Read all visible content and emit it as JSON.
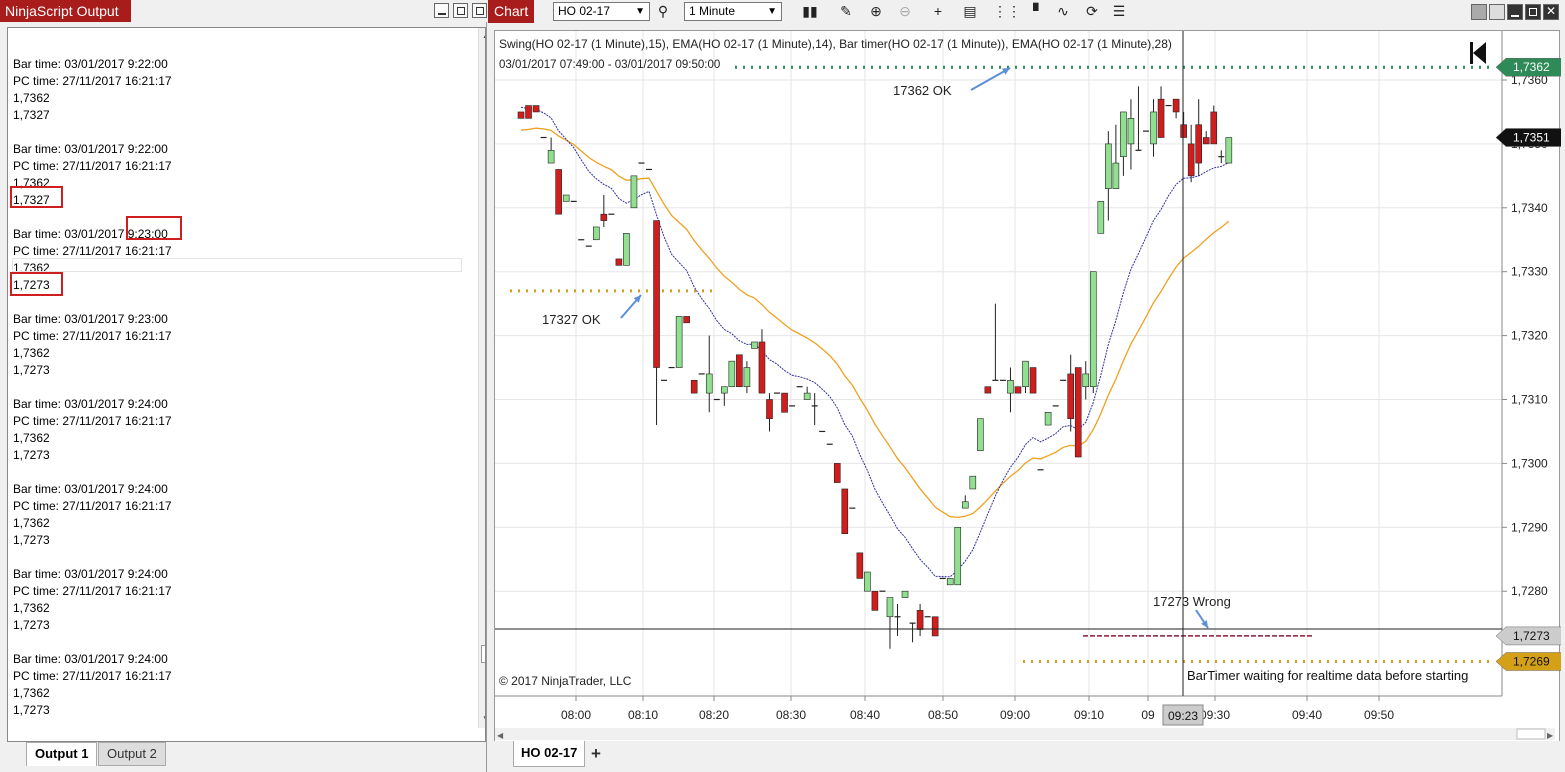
{
  "output": {
    "title": "NinjaScript Output",
    "blocks": [
      {
        "bar": "Bar time: 03/01/2017 9:22:00",
        "pc": "PC time: 27/11/2017 16:21:17",
        "v1": "1,7362",
        "v2": "1,7327"
      },
      {
        "bar": "Bar time: 03/01/2017 9:22:00",
        "pc": "PC time: 27/11/2017 16:21:17",
        "v1": "1,7362",
        "v2": "1,7327"
      },
      {
        "bar": "Bar time: 03/01/2017 9:23:00",
        "pc": "PC time: 27/11/2017 16:21:17",
        "v1": "1,7362",
        "v2": "1,7273"
      },
      {
        "bar": "Bar time: 03/01/2017 9:23:00",
        "pc": "PC time: 27/11/2017 16:21:17",
        "v1": "1,7362",
        "v2": "1,7273"
      },
      {
        "bar": "Bar time: 03/01/2017 9:24:00",
        "pc": "PC time: 27/11/2017 16:21:17",
        "v1": "1,7362",
        "v2": "1,7273"
      },
      {
        "bar": "Bar time: 03/01/2017 9:24:00",
        "pc": "PC time: 27/11/2017 16:21:17",
        "v1": "1,7362",
        "v2": "1,7273"
      },
      {
        "bar": "Bar time: 03/01/2017 9:24:00",
        "pc": "PC time: 27/11/2017 16:21:17",
        "v1": "1,7362",
        "v2": "1,7273"
      },
      {
        "bar": "Bar time: 03/01/2017 9:24:00",
        "pc": "PC time: 27/11/2017 16:21:17",
        "v1": "1,7362",
        "v2": "1,7273"
      }
    ],
    "tabs": [
      "Output 1",
      "Output 2"
    ]
  },
  "chart": {
    "title": "Chart",
    "instrument": "HO 02-17",
    "interval": "1 Minute",
    "indicator_line": "Swing(HO 02-17 (1 Minute),15), EMA(HO 02-17 (1 Minute),14), Bar timer(HO 02-17 (1 Minute)), EMA(HO 02-17 (1 Minute),28)",
    "range_line": "03/01/2017 07:49:00 - 03/01/2017 09:50:00",
    "copyright": "© 2017 NinjaTrader, LLC",
    "bartimer_msg": "BarTimer waiting for realtime data before starting",
    "annotations": [
      "17362  OK",
      "17327  OK",
      "17273  Wrong"
    ],
    "y_ticks": [
      "1,7360",
      "1,7350",
      "1,7340",
      "1,7330",
      "1,7320",
      "1,7310",
      "1,7300",
      "1,7290",
      "1,7280"
    ],
    "x_ticks": [
      "08:00",
      "08:10",
      "08:20",
      "08:30",
      "08:40",
      "08:50",
      "09:00",
      "09:10",
      "09",
      "09:30",
      "09:40",
      "09:50"
    ],
    "crosshair_time": "09:23",
    "price_tags": {
      "swing_high": "1,7362",
      "last": "1,7351",
      "crosshair": "1,7273",
      "swing_low": "1,7269"
    },
    "tab": "HO 02-17",
    "colors": {
      "up": "#90e090",
      "down": "#d01e1e",
      "ema14": "#3030a0",
      "ema28": "#f0a020",
      "swing_high": "#2e8b57",
      "swing_low": "#d4a017",
      "arrow": "#5b8fd8",
      "title_bar": "#a81c1c"
    }
  },
  "chart_data": {
    "type": "candlestick",
    "ylim": [
      1.7265,
      1.7363
    ],
    "candles": [
      [
        1.7355,
        1.7354,
        1.7354,
        1.7354
      ],
      [
        1.7356,
        1.7354,
        1.7355,
        1.7354
      ],
      [
        1.7356,
        1.7355,
        1.7355,
        1.7355
      ],
      [
        1.7351,
        1.7351,
        1.7351,
        1.7351
      ],
      [
        1.7347,
        1.7349,
        1.7351,
        1.7347
      ],
      [
        1.7346,
        1.7339,
        1.7346,
        1.7339
      ],
      [
        1.7341,
        1.7342,
        1.7342,
        1.7341
      ],
      [
        1.7341,
        1.7341,
        1.7341,
        1.7341
      ],
      [
        1.7335,
        1.7335,
        1.7335,
        1.7335
      ],
      [
        1.7334,
        1.7334,
        1.7334,
        1.7334
      ],
      [
        1.7335,
        1.7337,
        1.7337,
        1.7335
      ],
      [
        1.7339,
        1.7338,
        1.7342,
        1.7337
      ],
      [
        1.7339,
        1.7339,
        1.7339,
        1.7339
      ],
      [
        1.7332,
        1.7331,
        1.7332,
        1.7331
      ],
      [
        1.7331,
        1.7336,
        1.7336,
        1.7331
      ],
      [
        1.734,
        1.7345,
        1.7345,
        1.734
      ],
      [
        1.7347,
        1.7347,
        1.7347,
        1.7347
      ],
      [
        1.7346,
        1.7346,
        1.7346,
        1.7346
      ],
      [
        1.7338,
        1.7315,
        1.7338,
        1.7306
      ],
      [
        1.7313,
        1.7313,
        1.7313,
        1.7313
      ],
      [
        1.7315,
        1.7315,
        1.7315,
        1.7315
      ],
      [
        1.7315,
        1.7323,
        1.7323,
        1.7315
      ],
      [
        1.7323,
        1.7322,
        1.7323,
        1.7322
      ],
      [
        1.7313,
        1.7311,
        1.7313,
        1.7311
      ],
      [
        1.7314,
        1.7314,
        1.7314,
        1.7314
      ],
      [
        1.7311,
        1.7314,
        1.732,
        1.7308
      ],
      [
        1.731,
        1.731,
        1.731,
        1.731
      ],
      [
        1.7311,
        1.7312,
        1.7312,
        1.7309
      ],
      [
        1.7312,
        1.7316,
        1.7316,
        1.7312
      ],
      [
        1.7317,
        1.7312,
        1.7317,
        1.7312
      ],
      [
        1.7312,
        1.7315,
        1.7316,
        1.7311
      ],
      [
        1.7318,
        1.7319,
        1.7319,
        1.7318
      ],
      [
        1.7319,
        1.7311,
        1.7321,
        1.7311
      ],
      [
        1.731,
        1.7307,
        1.7311,
        1.7305
      ],
      [
        1.7311,
        1.7311,
        1.7311,
        1.7311
      ],
      [
        1.7311,
        1.7308,
        1.7311,
        1.7308
      ],
      [
        1.7309,
        1.7309,
        1.7309,
        1.7309
      ],
      [
        1.7312,
        1.7312,
        1.7312,
        1.7312
      ],
      [
        1.731,
        1.7311,
        1.7312,
        1.731
      ],
      [
        1.7309,
        1.7309,
        1.7311,
        1.7306
      ],
      [
        1.7305,
        1.7305,
        1.7305,
        1.7305
      ],
      [
        1.7303,
        1.7303,
        1.7303,
        1.7303
      ],
      [
        1.73,
        1.7297,
        1.73,
        1.7297
      ],
      [
        1.7296,
        1.7289,
        1.7296,
        1.7289
      ],
      [
        1.7293,
        1.7293,
        1.7293,
        1.7293
      ],
      [
        1.7286,
        1.7282,
        1.7286,
        1.7282
      ],
      [
        1.728,
        1.7283,
        1.7283,
        1.728
      ],
      [
        1.728,
        1.7277,
        1.728,
        1.7277
      ],
      [
        1.728,
        1.728,
        1.728,
        1.728
      ],
      [
        1.7276,
        1.7279,
        1.7279,
        1.7271
      ],
      [
        1.7276,
        1.7276,
        1.7278,
        1.7273
      ],
      [
        1.7279,
        1.728,
        1.728,
        1.7279
      ],
      [
        1.7275,
        1.7275,
        1.7275,
        1.7272
      ],
      [
        1.7277,
        1.7274,
        1.7278,
        1.7273
      ],
      [
        1.7276,
        1.7276,
        1.7276,
        1.7276
      ],
      [
        1.7276,
        1.7273,
        1.7276,
        1.7273
      ],
      [
        1.7282,
        1.7282,
        1.7282,
        1.7282
      ],
      [
        1.7281,
        1.7282,
        1.7282,
        1.7281
      ],
      [
        1.7281,
        1.729,
        1.729,
        1.7281
      ],
      [
        1.7293,
        1.7294,
        1.7295,
        1.7293
      ],
      [
        1.7296,
        1.7298,
        1.7298,
        1.7296
      ],
      [
        1.7302,
        1.7307,
        1.7307,
        1.7302
      ],
      [
        1.7312,
        1.7311,
        1.7312,
        1.7311
      ],
      [
        1.7313,
        1.7313,
        1.7325,
        1.7313
      ],
      [
        1.7313,
        1.7313,
        1.7313,
        1.7313
      ],
      [
        1.7311,
        1.7313,
        1.7315,
        1.7308
      ],
      [
        1.7312,
        1.7311,
        1.7312,
        1.7311
      ],
      [
        1.7312,
        1.7316,
        1.7316,
        1.7311
      ],
      [
        1.7315,
        1.7311,
        1.7315,
        1.7311
      ],
      [
        1.7299,
        1.7299,
        1.7299,
        1.7299
      ],
      [
        1.7306,
        1.7308,
        1.7308,
        1.7306
      ],
      [
        1.7309,
        1.7309,
        1.7309,
        1.7309
      ],
      [
        1.7313,
        1.7313,
        1.7313,
        1.7313
      ],
      [
        1.7314,
        1.7307,
        1.7317,
        1.7305
      ],
      [
        1.7315,
        1.7301,
        1.7315,
        1.7301
      ],
      [
        1.7312,
        1.7314,
        1.7316,
        1.731
      ],
      [
        1.7312,
        1.733,
        1.733,
        1.7311
      ],
      [
        1.7336,
        1.7341,
        1.7341,
        1.7336
      ],
      [
        1.7343,
        1.735,
        1.7352,
        1.7338
      ],
      [
        1.7343,
        1.7347,
        1.7353,
        1.7343
      ],
      [
        1.7348,
        1.7355,
        1.7355,
        1.7345
      ],
      [
        1.735,
        1.7354,
        1.7357,
        1.7346
      ],
      [
        1.7349,
        1.7349,
        1.7359,
        1.7349
      ],
      [
        1.7352,
        1.7352,
        1.7352,
        1.7352
      ],
      [
        1.735,
        1.7355,
        1.7357,
        1.7348
      ],
      [
        1.7357,
        1.7351,
        1.7359,
        1.7351
      ],
      [
        1.7356,
        1.7356,
        1.7356,
        1.7356
      ],
      [
        1.7357,
        1.7355,
        1.7357,
        1.7354
      ],
      [
        1.7353,
        1.7351,
        1.7355,
        1.7351
      ],
      [
        1.735,
        1.7345,
        1.7353,
        1.7344
      ],
      [
        1.7353,
        1.7347,
        1.7357,
        1.7345
      ],
      [
        1.7351,
        1.735,
        1.7352,
        1.735
      ],
      [
        1.7355,
        1.735,
        1.7356,
        1.735
      ],
      [
        1.7348,
        1.7348,
        1.7349,
        1.7347
      ],
      [
        1.7347,
        1.7351,
        1.7351,
        1.7347
      ]
    ],
    "swing_high": 1.7362,
    "swing_low_early": 1.7327,
    "swing_low": 1.7269,
    "wrong_level": 1.7273
  }
}
